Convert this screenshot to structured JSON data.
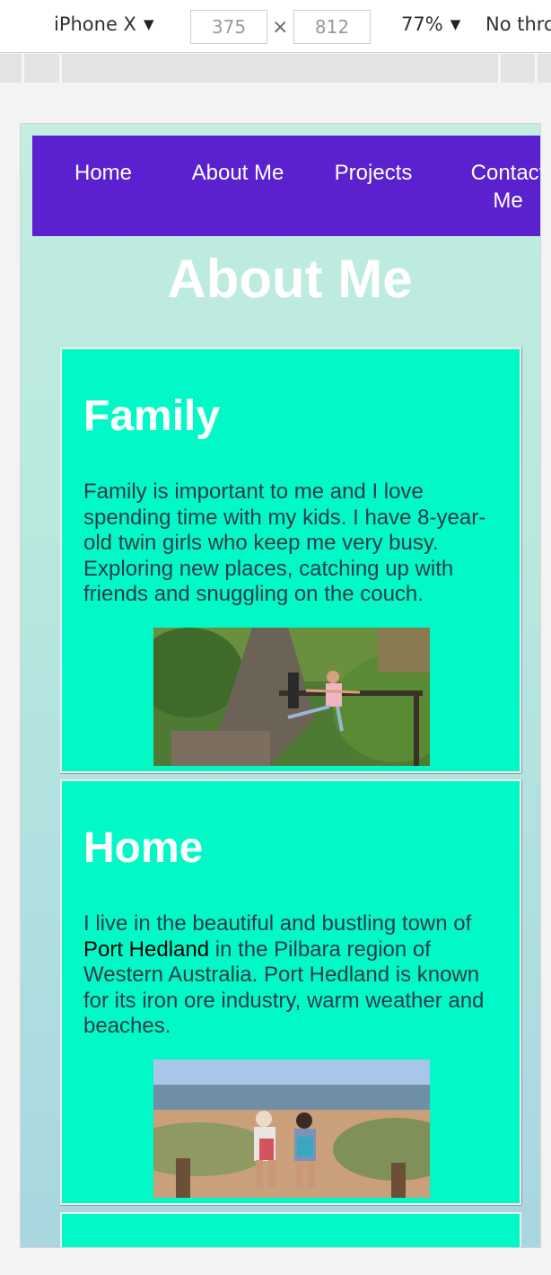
{
  "devtools": {
    "device": "iPhone X",
    "width": "375",
    "height": "812",
    "times": "×",
    "zoom": "77%",
    "throttle": "No thro"
  },
  "nav": {
    "items": [
      "Home",
      "About Me",
      "Projects",
      "Contact Me"
    ]
  },
  "page": {
    "title": "About Me"
  },
  "cards": [
    {
      "title": "Family",
      "text": "Family is important to me and I love spending time with my kids. I have 8-year-old twin girls who keep me very busy. Exploring new places, catching up with friends and snuggling on the couch."
    },
    {
      "title": "Home",
      "text_before": "I live in the beautiful and bustling town of ",
      "link": "Port Hedland",
      "text_after": " in the Pilbara region of Western Australia. Port Hedland is known for its iron ore industry, warm weather and beaches."
    }
  ],
  "colors": {
    "nav_bg": "#5b21cf",
    "card_bg": "#00f9c6",
    "page_bg": "#c2ede0"
  }
}
